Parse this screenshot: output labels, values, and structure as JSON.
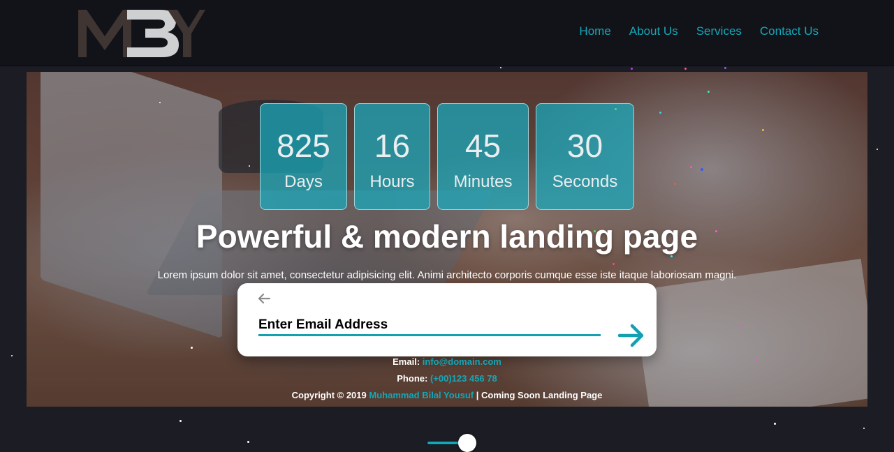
{
  "brand": {
    "logo_text": "MBY"
  },
  "nav": {
    "items": [
      {
        "label": "Home"
      },
      {
        "label": "About Us"
      },
      {
        "label": "Services"
      },
      {
        "label": "Contact Us"
      }
    ]
  },
  "countdown": {
    "days": {
      "value": "825",
      "label": "Days"
    },
    "hours": {
      "value": "16",
      "label": "Hours"
    },
    "minutes": {
      "value": "45",
      "label": "Minutes"
    },
    "seconds": {
      "value": "30",
      "label": "Seconds"
    }
  },
  "hero": {
    "headline": "Powerful & modern landing page",
    "subtext": "Lorem ipsum dolor sit amet, consectetur adipisicing elit. Animi architecto corporis cumque esse iste itaque laboriosam magni."
  },
  "signup": {
    "placeholder": "Enter Email Address",
    "back_icon": "arrow-left-icon",
    "submit_icon": "arrow-right-icon"
  },
  "contact": {
    "email_label": "Email:",
    "email_value": "info@domain.com",
    "phone_label": "Phone:",
    "phone_value": "(+00)123 456 78",
    "copyright_prefix": "Copyright © 2019",
    "author": "Muhammad Bilal Yousuf",
    "copyright_suffix": "| Coming Soon Landing Page"
  },
  "slider": {
    "value": 0.8
  },
  "colors": {
    "accent": "#14a7b8",
    "background": "#1b1c24",
    "header": "#121319",
    "logo_dark": "#3f3532",
    "logo_light": "#cfd0d2"
  }
}
